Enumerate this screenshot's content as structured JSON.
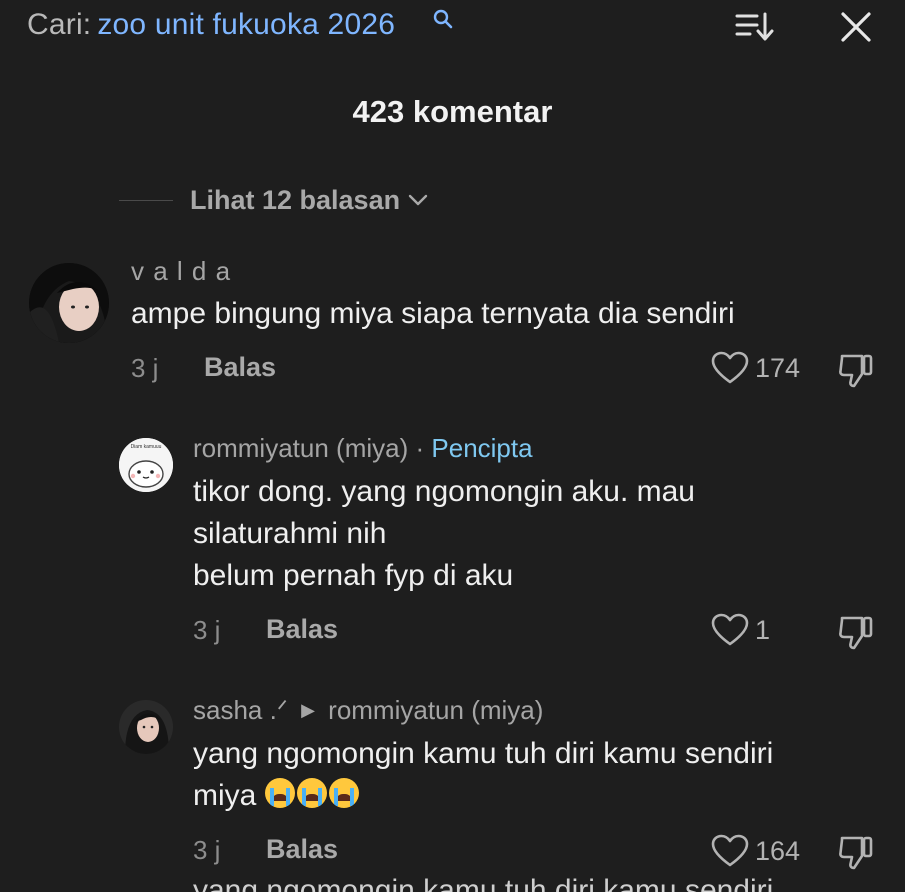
{
  "search": {
    "prefix": "Cari:",
    "query": "zoo unit fukuoka 2026"
  },
  "header": {
    "comment_count": "423 komentar"
  },
  "view_replies": {
    "label": "Lihat 12 balasan"
  },
  "comments": [
    {
      "username": "v a l d a",
      "text": "ampe bingung miya siapa ternyata dia sendiri",
      "time": "3 j",
      "reply_label": "Balas",
      "likes": "174"
    },
    {
      "username": "rommiyatun (miya)",
      "separator": "·",
      "badge": "Pencipta",
      "text_lines": [
        "tikor dong. yang ngomongin aku. mau",
        "silaturahmi nih",
        "belum pernah fyp di aku"
      ],
      "avatar_caption": "Diam kamuuu",
      "time": "3 j",
      "reply_label": "Balas",
      "likes": "1"
    },
    {
      "username": "sasha .ᐟ",
      "reply_to": "rommiyatun (miya)",
      "text_lines": [
        "yang ngomongin kamu tuh diri kamu sendiri",
        "miya"
      ],
      "time": "3 j",
      "reply_label": "Balas",
      "likes": "164"
    }
  ],
  "partial_next": "yang ngomongin kamu tuh diri kamu sendiri",
  "colors": {
    "background": "#1e1e1e",
    "accent_link": "#7fb6ff",
    "creator_badge": "#7fc8f0"
  },
  "icons": [
    "search-icon",
    "sort-icon",
    "close-icon",
    "chevron-down-icon",
    "heart-icon",
    "dislike-icon",
    "crying-emoji"
  ]
}
